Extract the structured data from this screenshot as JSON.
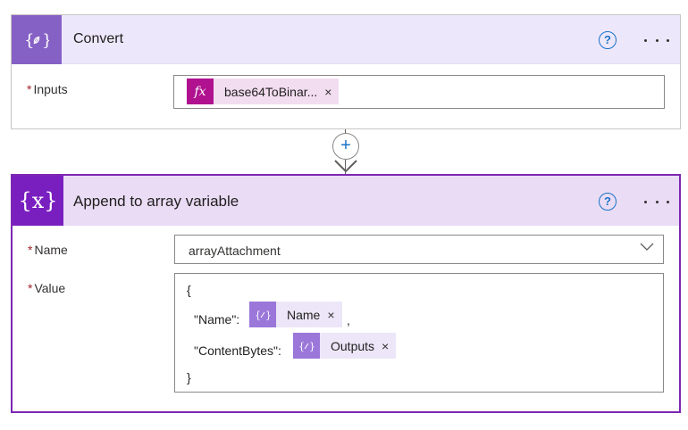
{
  "convert_card": {
    "title": "Convert",
    "icon": "expression-braces-icon",
    "help": "?",
    "inputs_label": "Inputs",
    "required_marker": "*",
    "input_token": {
      "label": "base64ToBinar...",
      "icon": "fx",
      "close": "×"
    }
  },
  "connector": {
    "add": "+"
  },
  "append_card": {
    "title": "Append to array variable",
    "icon": "{x}",
    "help": "?",
    "required_marker": "*",
    "name_label": "Name",
    "name_value": "arrayAttachment",
    "value_label": "Value",
    "value_lines": {
      "open_brace": "{",
      "name_key": "\"Name\":",
      "name_token": "Name",
      "comma": ",",
      "content_key": "\"ContentBytes\":",
      "content_token": "Outputs",
      "close_brace": "}"
    },
    "token_close": "×"
  },
  "colors": {
    "convert_header": "#ede7fb",
    "convert_icon_bg": "#8661c5",
    "append_border": "#7c27b2",
    "append_icon_bg": "#7a1fbf",
    "fx_bg": "#b0128f",
    "help_blue": "#1a73c6",
    "required_red": "#a4262c"
  }
}
